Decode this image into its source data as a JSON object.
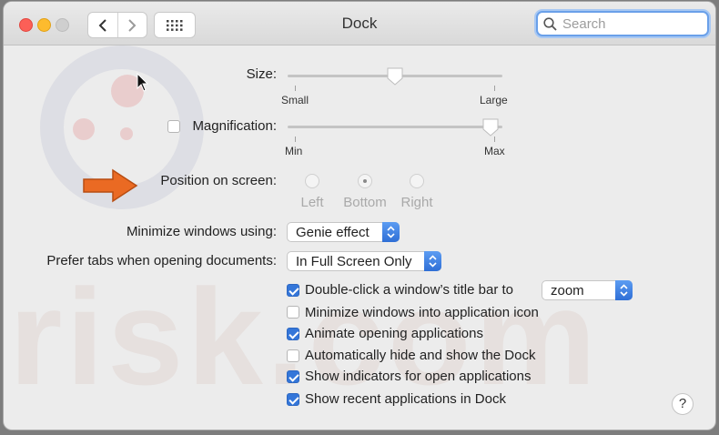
{
  "window": {
    "title": "Dock"
  },
  "toolbar": {
    "search_placeholder": "Search"
  },
  "watermark": {
    "text": "risk.com"
  },
  "size": {
    "label": "Size:",
    "min_label": "Small",
    "max_label": "Large",
    "value": 0.5
  },
  "magnification": {
    "label": "Magnification:",
    "min_label": "Min",
    "max_label": "Max",
    "checked": false,
    "value": 0.98
  },
  "position": {
    "label": "Position on screen:",
    "options": [
      "Left",
      "Bottom",
      "Right"
    ],
    "selected": "Bottom"
  },
  "minimize": {
    "label": "Minimize windows using:",
    "value": "Genie effect"
  },
  "prefer_tabs": {
    "label": "Prefer tabs when opening documents:",
    "value": "In Full Screen Only"
  },
  "options": [
    {
      "label": "Double-click a window’s title bar to",
      "checked": true
    },
    {
      "label": "Minimize windows into application icon",
      "checked": false
    },
    {
      "label": "Animate opening applications",
      "checked": true
    },
    {
      "label": "Automatically hide and show the Dock",
      "checked": false
    },
    {
      "label": "Show indicators for open applications",
      "checked": true
    },
    {
      "label": "Show recent applications in Dock",
      "checked": true
    }
  ],
  "double_click_action": {
    "value": "zoom"
  },
  "help": {
    "label": "?"
  },
  "colors": {
    "accent": "#3476d9",
    "close": "#fc5f57",
    "minimize": "#fdbb2e"
  }
}
